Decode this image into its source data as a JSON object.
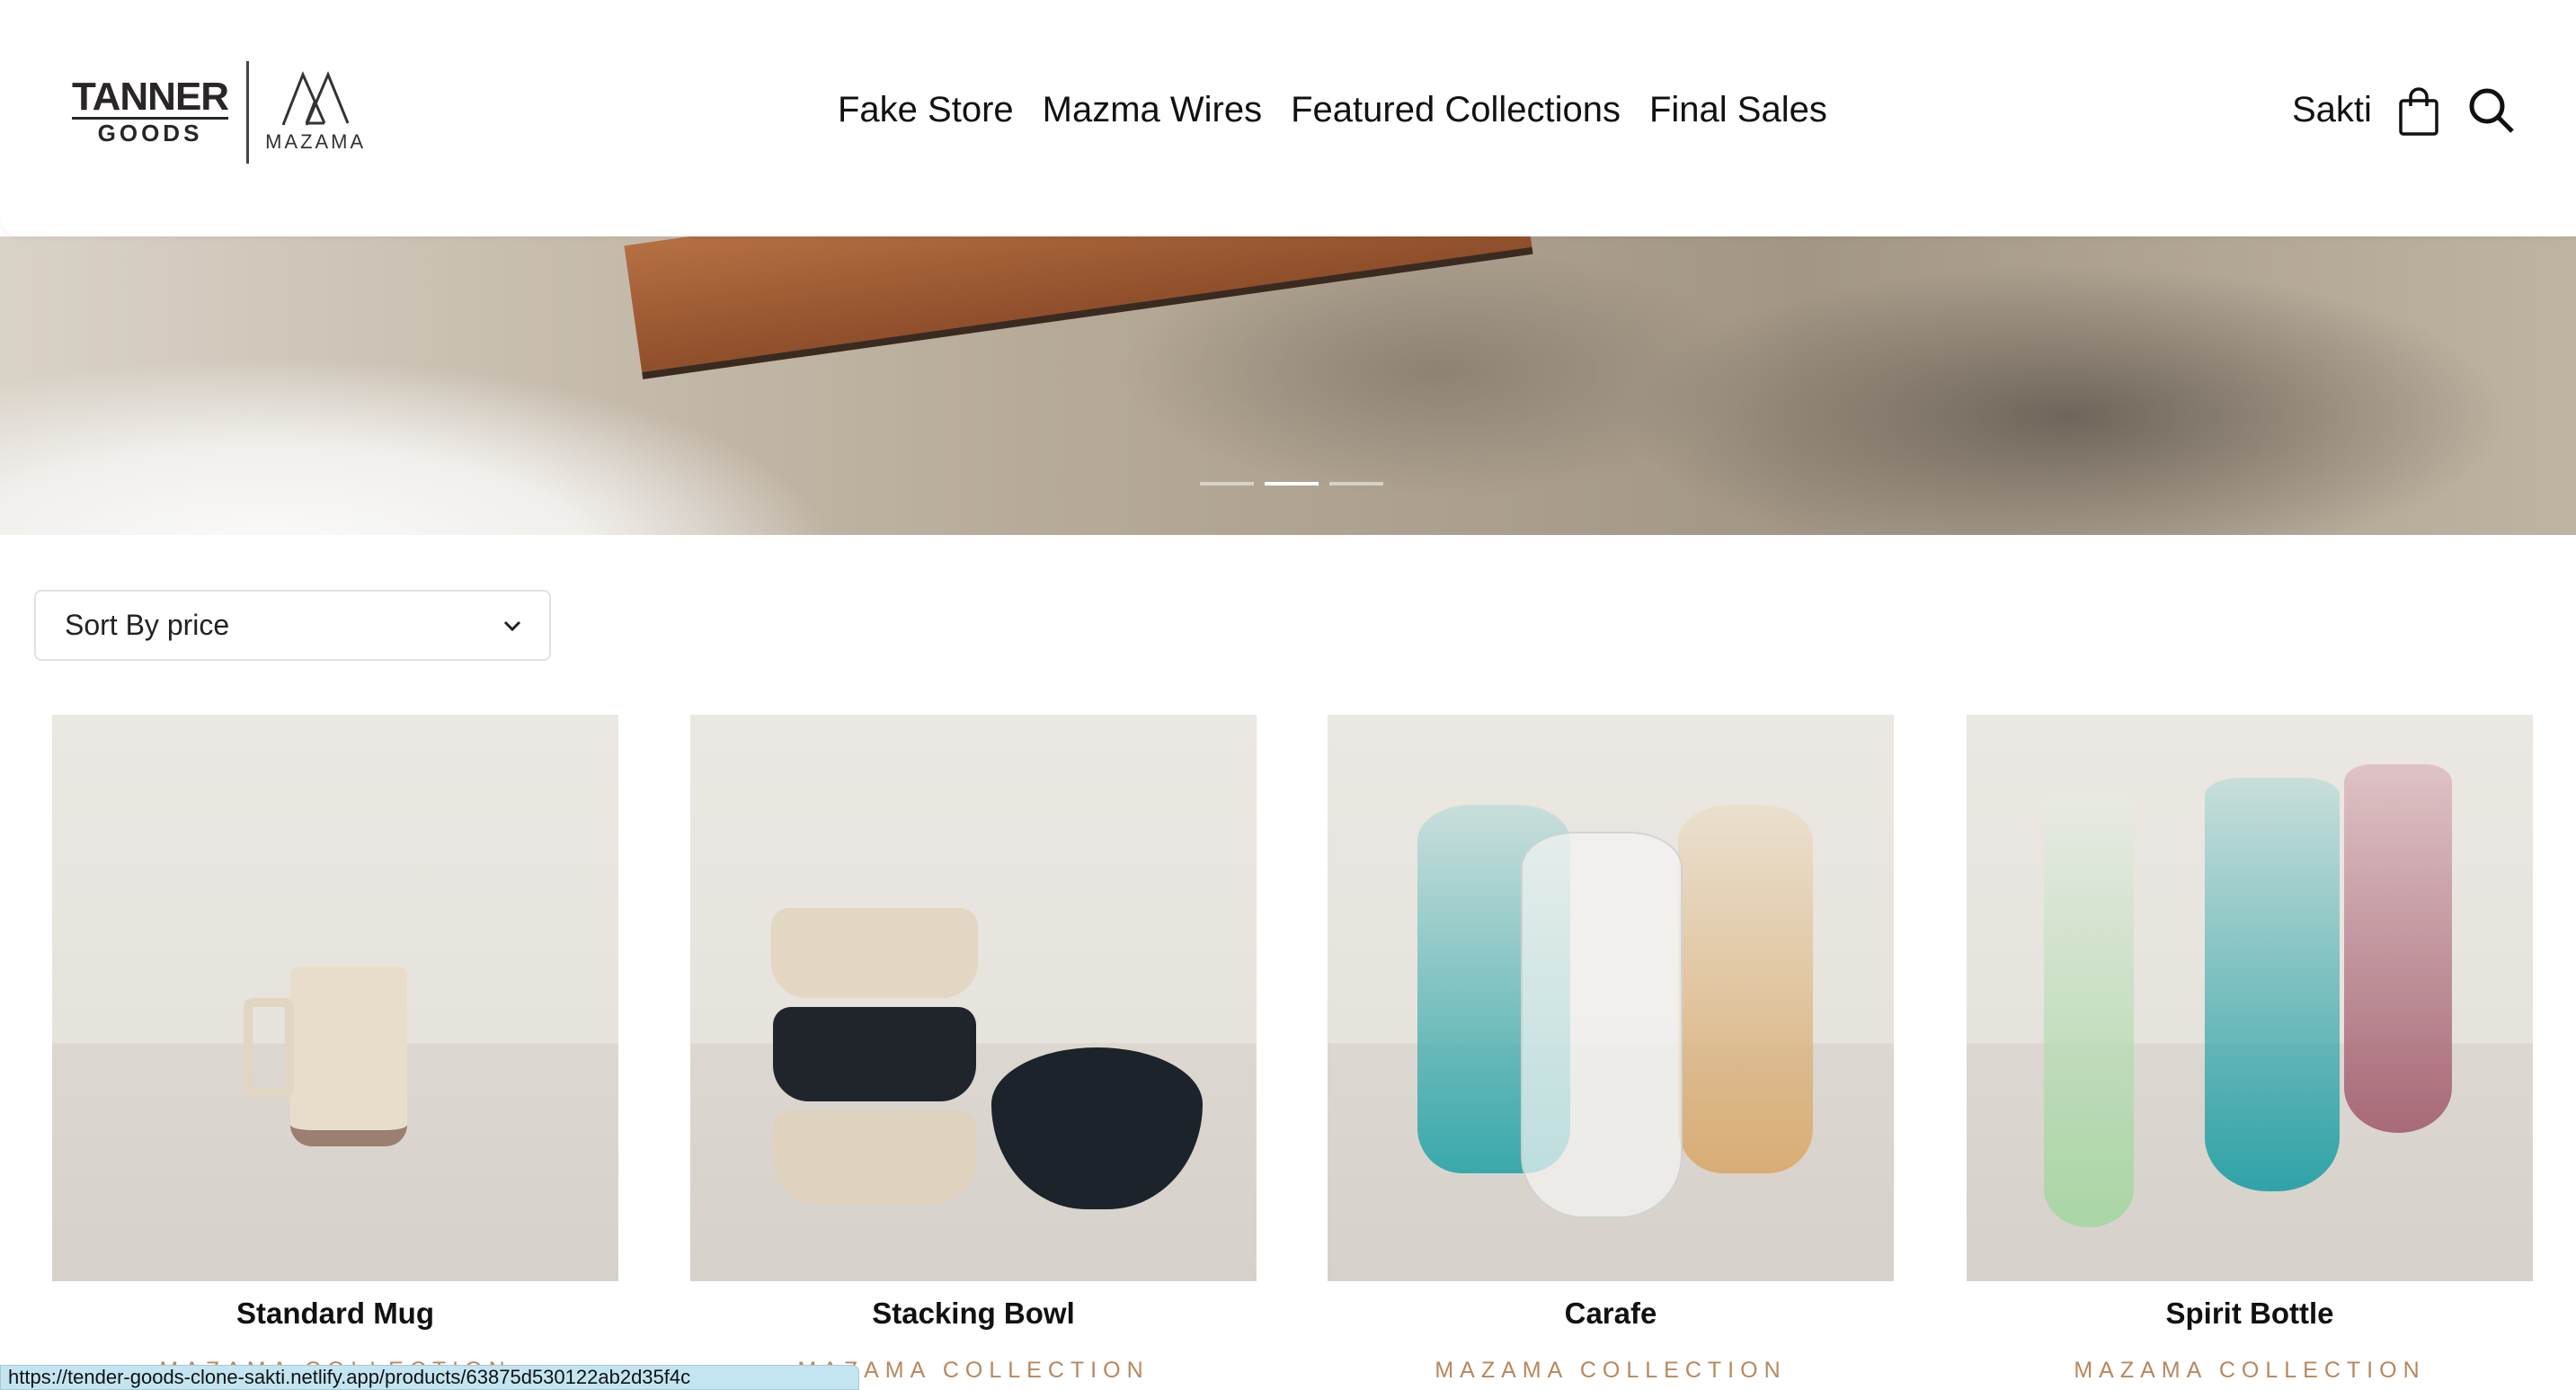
{
  "header": {
    "logo": {
      "left": "TANNER",
      "left_sub": "GOODS",
      "right": "MAZAMA"
    },
    "nav": [
      "Fake Store",
      "Mazma Wires",
      "Featured Collections",
      "Final Sales"
    ],
    "user": "Sakti",
    "icons": [
      "shopping-bag-icon",
      "search-icon"
    ]
  },
  "hero": {
    "slides": 3,
    "active_slide": 2
  },
  "sort": {
    "selected": "Sort By price"
  },
  "products": [
    {
      "title": "Standard Mug",
      "collection": "MAZAMA COLLECTION"
    },
    {
      "title": "Stacking Bowl",
      "collection": "MAZAMA COLLECTION"
    },
    {
      "title": "Carafe",
      "collection": "MAZAMA COLLECTION"
    },
    {
      "title": "Spirit Bottle",
      "collection": "MAZAMA COLLECTION"
    }
  ],
  "status_bar": {
    "url": "https://tender-goods-clone-sakti.netlify.app/products/63875d530122ab2d35f4c"
  },
  "colors": {
    "accent": "#b9875d",
    "status_bg": "#c3e5f1"
  }
}
